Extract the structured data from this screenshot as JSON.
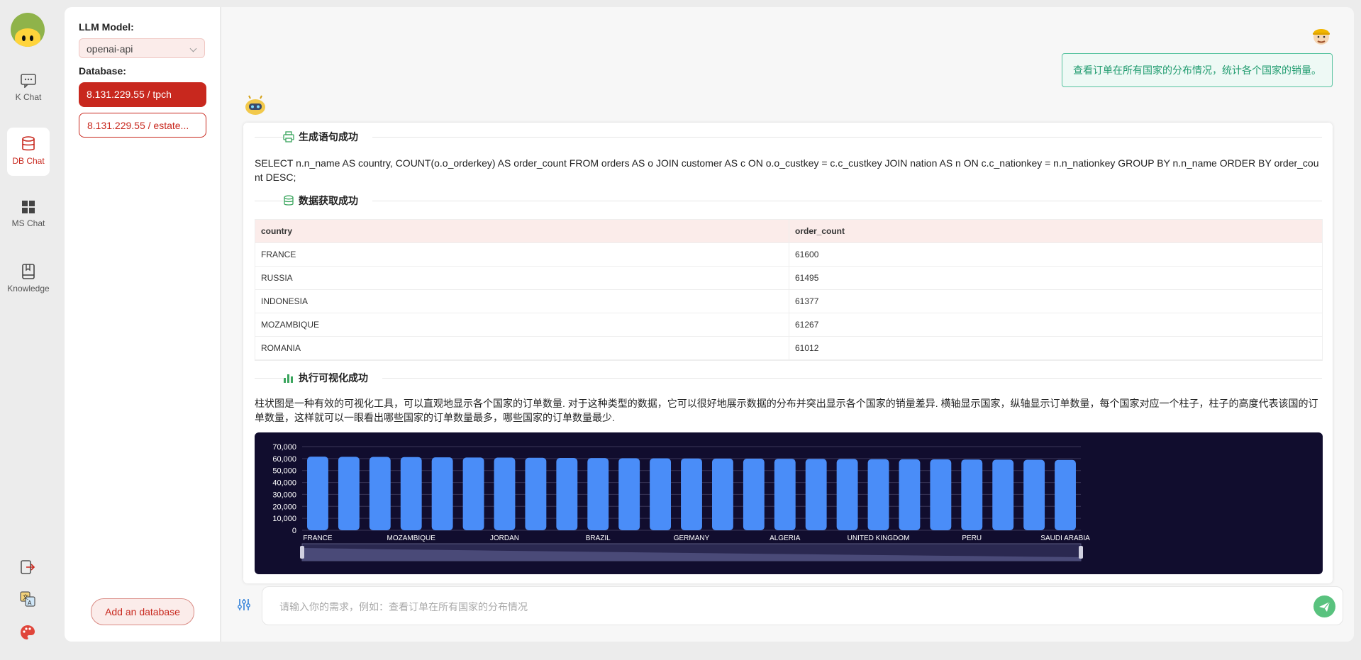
{
  "rail": {
    "items": [
      {
        "label": "K Chat"
      },
      {
        "label": "DB Chat"
      },
      {
        "label": "MS Chat"
      },
      {
        "label": "Knowledge"
      }
    ]
  },
  "panel": {
    "model_label": "LLM Model:",
    "model_value": "openai-api",
    "db_label": "Database:",
    "databases": [
      "8.131.229.55 / tpch",
      "8.131.229.55 / estate..."
    ],
    "add_button": "Add an database"
  },
  "chat": {
    "user_message": "查看订单在所有国家的分布情况，统计各个国家的销量。",
    "sec1_title": "生成语句成功",
    "sql": "SELECT n.n_name AS country, COUNT(o.o_orderkey) AS order_count FROM orders AS o JOIN customer AS c ON o.o_custkey = c.c_custkey JOIN nation AS n ON c.c_nationkey = n.n_nationkey GROUP BY n.n_name ORDER BY order_count DESC;",
    "sec2_title": "数据获取成功",
    "table": {
      "headers": [
        "country",
        "order_count"
      ],
      "rows": [
        [
          "FRANCE",
          "61600"
        ],
        [
          "RUSSIA",
          "61495"
        ],
        [
          "INDONESIA",
          "61377"
        ],
        [
          "MOZAMBIQUE",
          "61267"
        ],
        [
          "ROMANIA",
          "61012"
        ]
      ]
    },
    "sec3_title": "执行可视化成功",
    "description": "柱状图是一种有效的可视化工具，可以直观地显示各个国家的订单数量. 对于这种类型的数据，它可以很好地展示数据的分布并突出显示各个国家的销量差异. 横轴显示国家，纵轴显示订单数量，每个国家对应一个柱子，柱子的高度代表该国的订单数量，这样就可以一眼看出哪些国家的订单数量最多，哪些国家的订单数量最少.",
    "input_placeholder": "请输入你的需求，例如：查看订单在所有国家的分布情况"
  },
  "colors": {
    "brand": "#c8281e",
    "bar": "#4a8df8",
    "chart_bg": "#110d2e",
    "user_msg": "#1f9b6e"
  },
  "chart_data": {
    "type": "bar",
    "categories": [
      "FRANCE",
      "",
      "",
      "MOZAMBIQUE",
      "",
      "",
      "JORDAN",
      "",
      "",
      "BRAZIL",
      "",
      "",
      "GERMANY",
      "",
      "",
      "ALGERIA",
      "",
      "",
      "UNITED KINGDOM",
      "",
      "",
      "PERU",
      "",
      "",
      "SAUDI ARABIA"
    ],
    "values": [
      61600,
      61495,
      61377,
      61267,
      61012,
      60900,
      60800,
      60650,
      60500,
      60400,
      60300,
      60200,
      60100,
      60000,
      59900,
      59800,
      59700,
      59600,
      59500,
      59400,
      59300,
      59200,
      59100,
      59000,
      58900
    ],
    "yticks": [
      "70,000",
      "60,000",
      "50,000",
      "40,000",
      "30,000",
      "20,000",
      "10,000",
      "0"
    ],
    "ylim": [
      0,
      70000
    ],
    "xlabel": "",
    "ylabel": "",
    "legend": false,
    "grid": true
  }
}
